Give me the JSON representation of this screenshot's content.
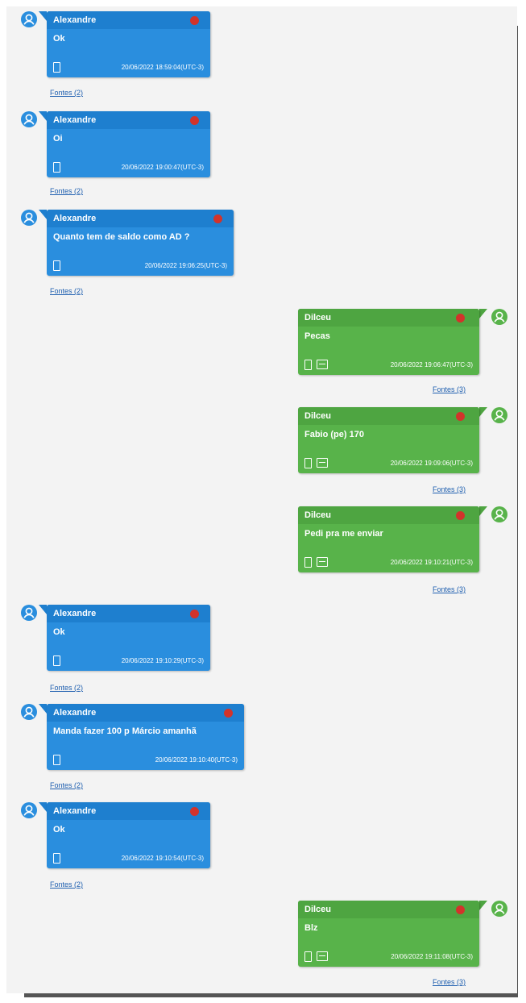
{
  "colors": {
    "sender_blue": "#2a8ede",
    "sender_green": "#58b34a",
    "deleted_dot": "#d2332b",
    "link": "#2060b0"
  },
  "messages": [
    {
      "side": "left",
      "sender": "Alexandre",
      "text": "Ok",
      "timestamp": "20/06/2022 18:59:04(UTC-3)",
      "link": "Fontes (2)"
    },
    {
      "side": "left",
      "sender": "Alexandre",
      "text": "Oi",
      "timestamp": "20/06/2022 19:00:47(UTC-3)",
      "link": "Fontes (2)"
    },
    {
      "side": "left",
      "sender": "Alexandre",
      "text": "Quanto tem de saldo como AD ?",
      "timestamp": "20/06/2022 19:06:25(UTC-3)",
      "link": "Fontes (2)"
    },
    {
      "side": "right",
      "sender": "Dilceu",
      "text": "Pecas",
      "timestamp": "20/06/2022 19:06:47(UTC-3)",
      "link": "Fontes (3)"
    },
    {
      "side": "right",
      "sender": "Dilceu",
      "text": "Fabio (pe) 170",
      "timestamp": "20/06/2022 19:09:06(UTC-3)",
      "link": "Fontes (3)"
    },
    {
      "side": "right",
      "sender": "Dilceu",
      "text": "Pedi pra me enviar",
      "timestamp": "20/06/2022 19:10:21(UTC-3)",
      "link": "Fontes (3)"
    },
    {
      "side": "left",
      "sender": "Alexandre",
      "text": "Ok",
      "timestamp": "20/06/2022 19:10:29(UTC-3)",
      "link": "Fontes (2)"
    },
    {
      "side": "left",
      "sender": "Alexandre",
      "text": "Manda fazer 100 p Márcio amanhã",
      "timestamp": "20/06/2022 19:10:40(UTC-3)",
      "link": "Fontes (2)"
    },
    {
      "side": "left",
      "sender": "Alexandre",
      "text": "Ok",
      "timestamp": "20/06/2022 19:10:54(UTC-3)",
      "link": "Fontes (2)"
    },
    {
      "side": "right",
      "sender": "Dilceu",
      "text": "Blz",
      "timestamp": "20/06/2022 19:11:08(UTC-3)",
      "link": "Fontes (3)"
    }
  ]
}
